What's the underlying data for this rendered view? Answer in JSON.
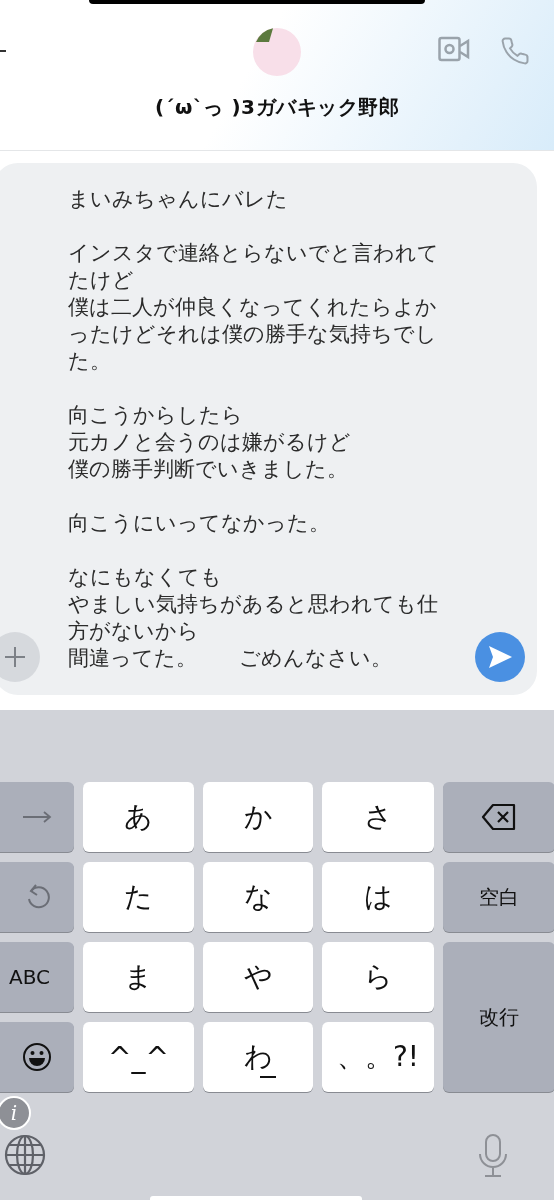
{
  "header": {
    "title": "(´ω`っ )3ガバキック野郎"
  },
  "composer": {
    "paragraphs": [
      [
        "まいみちゃんにバレた"
      ],
      [
        "インスタで連絡とらないでと言われてたけど",
        "僕は二人が仲良くなってくれたらよかったけどそれは僕の勝手な気持ちでした。"
      ],
      [
        "向こうからしたら",
        "元カノと会うのは嫌がるけど",
        "僕の勝手判断でいきました。"
      ],
      [
        "向こうにいってなかった。"
      ],
      [
        "なにもなくても",
        "やましい気持ちがあると思われても仕方がないから",
        "間違ってた。　　ごめんなさい。"
      ]
    ]
  },
  "keyboard": {
    "rows": [
      [
        {
          "kind": "arrow"
        },
        {
          "kind": "char",
          "label": "あ"
        },
        {
          "kind": "char",
          "label": "か"
        },
        {
          "kind": "char",
          "label": "さ"
        },
        {
          "kind": "delete"
        }
      ],
      [
        {
          "kind": "undo"
        },
        {
          "kind": "char",
          "label": "た"
        },
        {
          "kind": "char",
          "label": "な"
        },
        {
          "kind": "char",
          "label": "は"
        },
        {
          "kind": "func",
          "label": "空白"
        }
      ],
      [
        {
          "kind": "func",
          "label": "ABC"
        },
        {
          "kind": "char",
          "label": "ま"
        },
        {
          "kind": "char",
          "label": "や"
        },
        {
          "kind": "char",
          "label": "ら"
        },
        {
          "kind": "func",
          "label": "改行",
          "tall": true
        }
      ],
      [
        {
          "kind": "emoji"
        },
        {
          "kind": "char",
          "label": "^_^"
        },
        {
          "kind": "char",
          "label": "わ",
          "underline": true
        },
        {
          "kind": "char",
          "label": "、。?!"
        }
      ]
    ],
    "info_badge": "i"
  }
}
